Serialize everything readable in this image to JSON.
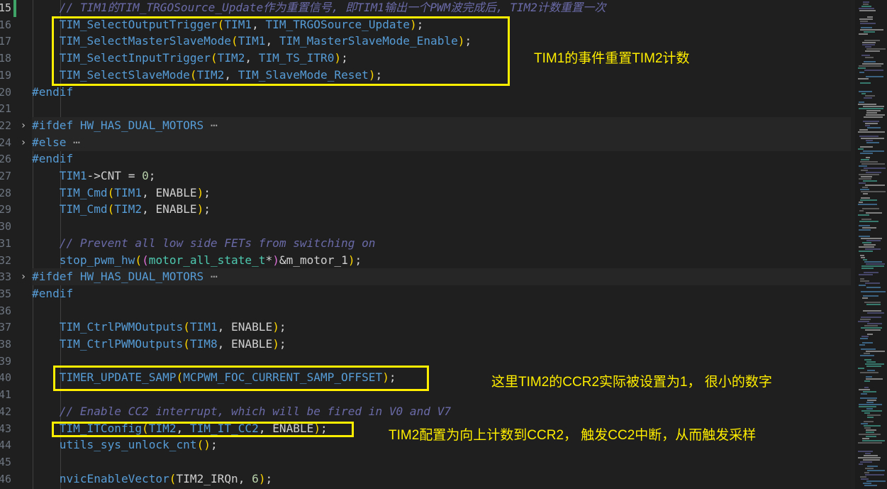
{
  "editor": {
    "lines": [
      {
        "n": "15",
        "tokens": [
          [
            "cm",
            "    // TIM1的TIM_TRGOSource_Update作为重置信号, 即TIM1输出一个PWM波完成后, TIM2计数重置一次"
          ]
        ]
      },
      {
        "n": "16",
        "tokens": [
          [
            "pu",
            "    "
          ],
          [
            "fn",
            "TIM_SelectOutputTrigger"
          ],
          [
            "p1",
            "("
          ],
          [
            "fn",
            "TIM1"
          ],
          [
            "pu",
            ", "
          ],
          [
            "fn",
            "TIM_TRGOSource_Update"
          ],
          [
            "p1",
            ")"
          ],
          [
            "pu",
            ";"
          ]
        ]
      },
      {
        "n": "17",
        "tokens": [
          [
            "pu",
            "    "
          ],
          [
            "fn",
            "TIM_SelectMasterSlaveMode"
          ],
          [
            "p1",
            "("
          ],
          [
            "fn",
            "TIM1"
          ],
          [
            "pu",
            ", "
          ],
          [
            "fn",
            "TIM_MasterSlaveMode_Enable"
          ],
          [
            "p1",
            ")"
          ],
          [
            "pu",
            ";"
          ]
        ]
      },
      {
        "n": "18",
        "tokens": [
          [
            "pu",
            "    "
          ],
          [
            "fn",
            "TIM_SelectInputTrigger"
          ],
          [
            "p1",
            "("
          ],
          [
            "fn",
            "TIM2"
          ],
          [
            "pu",
            ", "
          ],
          [
            "fn",
            "TIM_TS_ITR0"
          ],
          [
            "p1",
            ")"
          ],
          [
            "pu",
            ";"
          ]
        ]
      },
      {
        "n": "19",
        "tokens": [
          [
            "pu",
            "    "
          ],
          [
            "fn",
            "TIM_SelectSlaveMode"
          ],
          [
            "p1",
            "("
          ],
          [
            "fn",
            "TIM2"
          ],
          [
            "pu",
            ", "
          ],
          [
            "fn",
            "TIM_SlaveMode_Reset"
          ],
          [
            "p1",
            ")"
          ],
          [
            "pu",
            ";"
          ]
        ]
      },
      {
        "n": "20",
        "tokens": [
          [
            "pp",
            "#endif"
          ]
        ]
      },
      {
        "n": "21",
        "tokens": []
      },
      {
        "n": "22",
        "fold": "›",
        "folded": true,
        "tokens": [
          [
            "pp",
            "#ifdef "
          ],
          [
            "fn",
            "HW_HAS_DUAL_MOTORS"
          ],
          [
            "ellipsis",
            " ⋯"
          ]
        ]
      },
      {
        "n": "24",
        "fold": "›",
        "folded": true,
        "tokens": [
          [
            "pp",
            "#else"
          ],
          [
            "ellipsis",
            " ⋯"
          ]
        ]
      },
      {
        "n": "26",
        "tokens": [
          [
            "pp",
            "#endif"
          ]
        ]
      },
      {
        "n": "27",
        "tokens": [
          [
            "pu",
            "    "
          ],
          [
            "fn",
            "TIM1"
          ],
          [
            "pu",
            "->"
          ],
          [
            "id",
            "CNT"
          ],
          [
            "pu",
            " = "
          ],
          [
            "num",
            "0"
          ],
          [
            "pu",
            ";"
          ]
        ]
      },
      {
        "n": "28",
        "tokens": [
          [
            "pu",
            "    "
          ],
          [
            "fn",
            "TIM_Cmd"
          ],
          [
            "p1",
            "("
          ],
          [
            "fn",
            "TIM1"
          ],
          [
            "pu",
            ", "
          ],
          [
            "id",
            "ENABLE"
          ],
          [
            "p1",
            ")"
          ],
          [
            "pu",
            ";"
          ]
        ]
      },
      {
        "n": "29",
        "tokens": [
          [
            "pu",
            "    "
          ],
          [
            "fn",
            "TIM_Cmd"
          ],
          [
            "p1",
            "("
          ],
          [
            "fn",
            "TIM2"
          ],
          [
            "pu",
            ", "
          ],
          [
            "id",
            "ENABLE"
          ],
          [
            "p1",
            ")"
          ],
          [
            "pu",
            ";"
          ]
        ]
      },
      {
        "n": "30",
        "tokens": []
      },
      {
        "n": "31",
        "tokens": [
          [
            "cm",
            "    // Prevent all low side FETs from switching on"
          ]
        ]
      },
      {
        "n": "32",
        "tokens": [
          [
            "pu",
            "    "
          ],
          [
            "fn",
            "stop_pwm_hw"
          ],
          [
            "p1",
            "("
          ],
          [
            "p2",
            "("
          ],
          [
            "ty",
            "motor_all_state_t"
          ],
          [
            "pu",
            "*"
          ],
          [
            "p2",
            ")"
          ],
          [
            "pu",
            "&"
          ],
          [
            "id",
            "m_motor_1"
          ],
          [
            "p1",
            ")"
          ],
          [
            "pu",
            ";"
          ]
        ]
      },
      {
        "n": "33",
        "fold": "›",
        "folded": true,
        "tokens": [
          [
            "pp",
            "#ifdef "
          ],
          [
            "fn",
            "HW_HAS_DUAL_MOTORS"
          ],
          [
            "ellipsis",
            " ⋯"
          ]
        ]
      },
      {
        "n": "35",
        "tokens": [
          [
            "pp",
            "#endif"
          ]
        ]
      },
      {
        "n": "36",
        "tokens": []
      },
      {
        "n": "37",
        "tokens": [
          [
            "pu",
            "    "
          ],
          [
            "fn",
            "TIM_CtrlPWMOutputs"
          ],
          [
            "p1",
            "("
          ],
          [
            "fn",
            "TIM1"
          ],
          [
            "pu",
            ", "
          ],
          [
            "id",
            "ENABLE"
          ],
          [
            "p1",
            ")"
          ],
          [
            "pu",
            ";"
          ]
        ]
      },
      {
        "n": "38",
        "tokens": [
          [
            "pu",
            "    "
          ],
          [
            "fn",
            "TIM_CtrlPWMOutputs"
          ],
          [
            "p1",
            "("
          ],
          [
            "fn",
            "TIM8"
          ],
          [
            "pu",
            ", "
          ],
          [
            "id",
            "ENABLE"
          ],
          [
            "p1",
            ")"
          ],
          [
            "pu",
            ";"
          ]
        ]
      },
      {
        "n": "39",
        "tokens": []
      },
      {
        "n": "40",
        "tokens": [
          [
            "pu",
            "    "
          ],
          [
            "fn",
            "TIMER_UPDATE_SAMP"
          ],
          [
            "p1",
            "("
          ],
          [
            "fn",
            "MCPWM_FOC_CURRENT_SAMP_OFFSET"
          ],
          [
            "p1",
            ")"
          ],
          [
            "pu",
            ";"
          ]
        ]
      },
      {
        "n": "41",
        "tokens": []
      },
      {
        "n": "42",
        "tokens": [
          [
            "cm",
            "    // Enable CC2 interrupt, which will be fired in V0 and V7"
          ]
        ]
      },
      {
        "n": "43",
        "tokens": [
          [
            "pu",
            "    "
          ],
          [
            "fn",
            "TIM_ITConfig"
          ],
          [
            "p1",
            "("
          ],
          [
            "fn",
            "TIM2"
          ],
          [
            "pu",
            ", "
          ],
          [
            "fn",
            "TIM_IT_CC2"
          ],
          [
            "pu",
            ", "
          ],
          [
            "id",
            "ENABLE"
          ],
          [
            "p1",
            ")"
          ],
          [
            "pu",
            ";"
          ]
        ]
      },
      {
        "n": "44",
        "tokens": [
          [
            "pu",
            "    "
          ],
          [
            "fn",
            "utils_sys_unlock_cnt"
          ],
          [
            "p1",
            "()"
          ],
          [
            "pu",
            ";"
          ]
        ]
      },
      {
        "n": "45",
        "tokens": []
      },
      {
        "n": "46",
        "tokens": [
          [
            "pu",
            "    "
          ],
          [
            "fn",
            "nvicEnableVector"
          ],
          [
            "p1",
            "("
          ],
          [
            "id",
            "TIM2_IRQn"
          ],
          [
            "pu",
            ", "
          ],
          [
            "num",
            "6"
          ],
          [
            "p1",
            ")"
          ],
          [
            "pu",
            ";"
          ]
        ]
      }
    ]
  },
  "annotations": [
    {
      "name": "annotation-tim1-event-reset",
      "text": "TIM1的事件重置TIM2计数"
    },
    {
      "name": "annotation-ccr2-value",
      "text": "这里TIM2的CCR2实际被设置为1， 很小的数字"
    },
    {
      "name": "annotation-cc2-interrupt",
      "text": "TIM2配置为向上计数到CCR2， 触发CC2中断，从而触发采样"
    }
  ],
  "colors": {
    "background": "#1f1f1f",
    "highlight_box": "#ffee00",
    "function": "#569cd6",
    "comment": "#6a6aa8",
    "type": "#4ec9b0",
    "number": "#b5cea8"
  }
}
